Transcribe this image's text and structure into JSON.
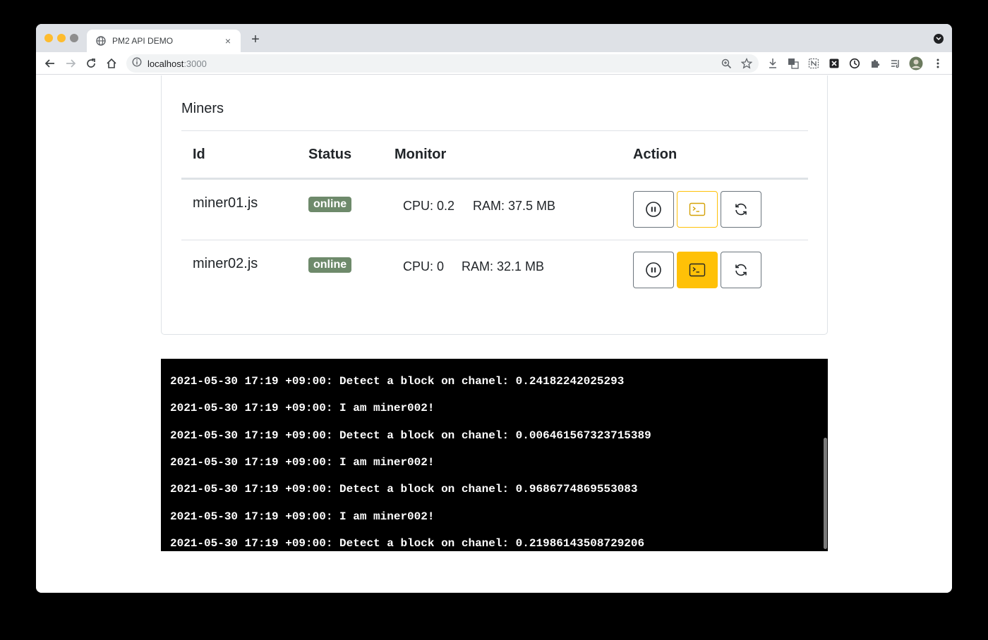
{
  "browser": {
    "tab_title": "PM2 API DEMO",
    "tab_close": "×",
    "new_tab": "+",
    "url_host": "localhost",
    "url_port": ":3000"
  },
  "card": {
    "title": "Miners",
    "columns": [
      "Id",
      "Status",
      "Monitor",
      "Action"
    ],
    "rows": [
      {
        "id": "miner01.js",
        "status": "online",
        "cpu": "CPU: 0.2",
        "ram": "RAM: 37.5 MB",
        "log_active": false
      },
      {
        "id": "miner02.js",
        "status": "online",
        "cpu": "CPU: 0",
        "ram": "RAM: 32.1 MB",
        "log_active": true
      }
    ]
  },
  "terminal": {
    "lines": [
      "2021-05-30 17:19 +09:00: Detect a block on chanel: 0.24182242025293",
      "2021-05-30 17:19 +09:00: I am miner002!",
      "2021-05-30 17:19 +09:00: Detect a block on chanel: 0.006461567323715389",
      "2021-05-30 17:19 +09:00: I am miner002!",
      "2021-05-30 17:19 +09:00: Detect a block on chanel: 0.9686774869553083",
      "2021-05-30 17:19 +09:00: I am miner002!",
      "2021-05-30 17:19 +09:00: Detect a block on chanel: 0.21986143508729206"
    ]
  },
  "colors": {
    "badge": "#6e8a6b",
    "warning": "#ffc107",
    "terminal_bg": "#000000"
  }
}
